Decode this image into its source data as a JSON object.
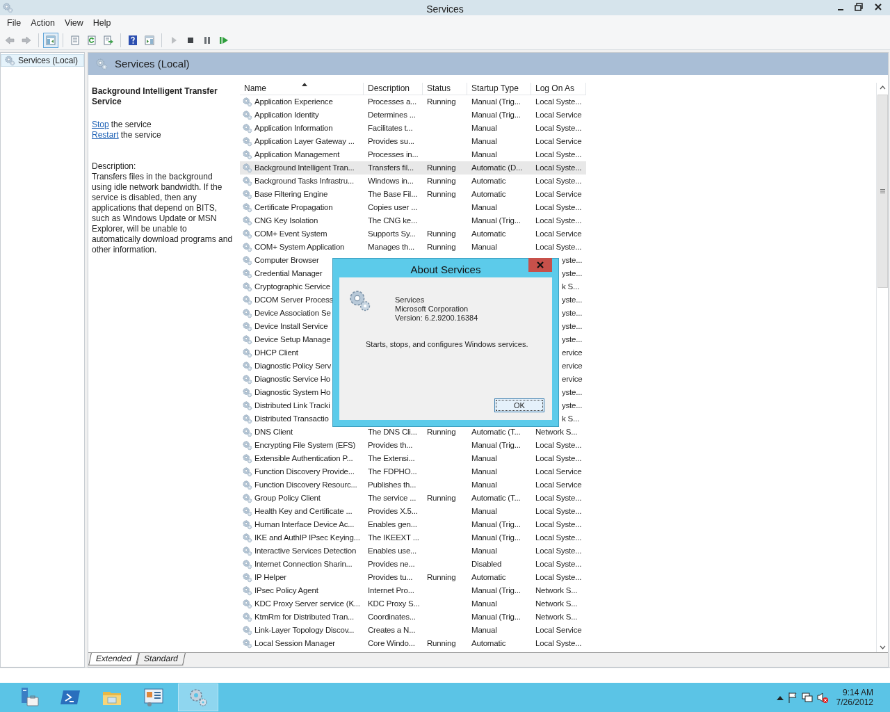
{
  "window": {
    "title": "Services"
  },
  "menu": [
    "File",
    "Action",
    "View",
    "Help"
  ],
  "toolbar": [
    {
      "kind": "back",
      "disabled": true
    },
    {
      "kind": "forward",
      "disabled": true
    },
    {
      "kind": "sep"
    },
    {
      "kind": "console_tree",
      "pressed": true
    },
    {
      "kind": "sep"
    },
    {
      "kind": "properties"
    },
    {
      "kind": "refresh"
    },
    {
      "kind": "export"
    },
    {
      "kind": "sep"
    },
    {
      "kind": "help"
    },
    {
      "kind": "view"
    },
    {
      "kind": "sep"
    },
    {
      "kind": "start",
      "disabled": true
    },
    {
      "kind": "stop"
    },
    {
      "kind": "pause"
    },
    {
      "kind": "resume"
    }
  ],
  "tree": [
    {
      "label": "Services (Local)",
      "selected": true
    }
  ],
  "pane_header": "Services (Local)",
  "details": {
    "title": "Background Intelligent Transfer Service",
    "actions": [
      {
        "link": "Stop",
        "text": "the service"
      },
      {
        "link": "Restart",
        "text": "the service"
      }
    ],
    "description_label": "Description:",
    "description": "Transfers files in the background using idle network bandwidth. If the service is disabled, then any applications that depend on BITS, such as Windows Update or MSN Explorer, will be unable to automatically download programs and other information."
  },
  "table": {
    "columns": [
      {
        "label": "Name",
        "sorted": true
      },
      {
        "label": "Description",
        "sorted": false
      },
      {
        "label": "Status",
        "sorted": false
      },
      {
        "label": "Startup Type",
        "sorted": false
      },
      {
        "label": "Log On As",
        "sorted": false
      }
    ],
    "rows": [
      {
        "kind": "full",
        "selected": false,
        "name": "Application Experience",
        "description": "Processes a...",
        "status": "Running",
        "startup_type": "Manual (Trig...",
        "log_on_as": "Local Syste..."
      },
      {
        "kind": "full",
        "selected": false,
        "name": "Application Identity",
        "description": "Determines ...",
        "startup_type": "Manual (Trig...",
        "log_on_as": "Local Service"
      },
      {
        "kind": "full",
        "selected": false,
        "name": "Application Information",
        "description": "Facilitates t...",
        "startup_type": "Manual",
        "log_on_as": "Local Syste..."
      },
      {
        "kind": "full",
        "selected": false,
        "name": "Application Layer Gateway ...",
        "description": "Provides su...",
        "startup_type": "Manual",
        "log_on_as": "Local Service"
      },
      {
        "kind": "full",
        "selected": false,
        "name": "Application Management",
        "description": "Processes in...",
        "startup_type": "Manual",
        "log_on_as": "Local Syste..."
      },
      {
        "kind": "full",
        "selected": true,
        "name": "Background Intelligent Tran...",
        "description": "Transfers fil...",
        "status": "Running",
        "startup_type": "Automatic (D...",
        "log_on_as": "Local Syste..."
      },
      {
        "kind": "full",
        "selected": false,
        "name": "Background Tasks Infrastru...",
        "description": "Windows in...",
        "status": "Running",
        "startup_type": "Automatic",
        "log_on_as": "Local Syste..."
      },
      {
        "kind": "full",
        "selected": false,
        "name": "Base Filtering Engine",
        "description": "The Base Fil...",
        "status": "Running",
        "startup_type": "Automatic",
        "log_on_as": "Local Service"
      },
      {
        "kind": "full",
        "selected": false,
        "name": "Certificate Propagation",
        "description": "Copies user ...",
        "startup_type": "Manual",
        "log_on_as": "Local Syste..."
      },
      {
        "kind": "full",
        "selected": false,
        "name": "CNG Key Isolation",
        "description": "The CNG ke...",
        "startup_type": "Manual (Trig...",
        "log_on_as": "Local Syste..."
      },
      {
        "kind": "full",
        "selected": false,
        "name": "COM+ Event System",
        "description": "Supports Sy...",
        "status": "Running",
        "startup_type": "Automatic",
        "log_on_as": "Local Service"
      },
      {
        "kind": "full",
        "selected": false,
        "name": "COM+ System Application",
        "description": "Manages th...",
        "status": "Running",
        "startup_type": "Manual",
        "log_on_as": "Local Syste..."
      },
      {
        "kind": "covered",
        "selected": false,
        "name": "Computer Browser",
        "log_on_as": "yste..."
      },
      {
        "kind": "covered",
        "selected": false,
        "name": "Credential Manager",
        "log_on_as": "yste..."
      },
      {
        "kind": "covered",
        "selected": false,
        "name": "Cryptographic Service",
        "log_on_as": "k S..."
      },
      {
        "kind": "covered",
        "selected": false,
        "name": "DCOM Server Process",
        "log_on_as": "yste..."
      },
      {
        "kind": "covered",
        "selected": false,
        "name": "Device Association Se",
        "log_on_as": "yste..."
      },
      {
        "kind": "covered",
        "selected": false,
        "name": "Device Install Service",
        "log_on_as": "yste..."
      },
      {
        "kind": "covered",
        "selected": false,
        "name": "Device Setup Manage",
        "log_on_as": "yste..."
      },
      {
        "kind": "covered",
        "selected": false,
        "name": "DHCP Client",
        "log_on_as": "ervice"
      },
      {
        "kind": "covered",
        "selected": false,
        "name": "Diagnostic Policy Serv",
        "log_on_as": "ervice"
      },
      {
        "kind": "covered",
        "selected": false,
        "name": "Diagnostic Service Ho",
        "log_on_as": "ervice"
      },
      {
        "kind": "covered",
        "selected": false,
        "name": "Diagnostic System Ho",
        "log_on_as": "yste..."
      },
      {
        "kind": "covered",
        "selected": false,
        "name": "Distributed Link Tracki",
        "log_on_as": "yste..."
      },
      {
        "kind": "covered",
        "selected": false,
        "name": "Distributed Transactio",
        "log_on_as": "k S..."
      },
      {
        "kind": "full",
        "selected": false,
        "name": "DNS Client",
        "description": "The DNS Cli...",
        "status": "Running",
        "startup_type": "Automatic (T...",
        "log_on_as": "Network S..."
      },
      {
        "kind": "full",
        "selected": false,
        "name": "Encrypting File System (EFS)",
        "description": "Provides th...",
        "startup_type": "Manual (Trig...",
        "log_on_as": "Local Syste..."
      },
      {
        "kind": "full",
        "selected": false,
        "name": "Extensible Authentication P...",
        "description": "The Extensi...",
        "startup_type": "Manual",
        "log_on_as": "Local Syste..."
      },
      {
        "kind": "full",
        "selected": false,
        "name": "Function Discovery Provide...",
        "description": "The FDPHO...",
        "startup_type": "Manual",
        "log_on_as": "Local Service"
      },
      {
        "kind": "full",
        "selected": false,
        "name": "Function Discovery Resourc...",
        "description": "Publishes th...",
        "startup_type": "Manual",
        "log_on_as": "Local Service"
      },
      {
        "kind": "full",
        "selected": false,
        "name": "Group Policy Client",
        "description": "The service ...",
        "status": "Running",
        "startup_type": "Automatic (T...",
        "log_on_as": "Local Syste..."
      },
      {
        "kind": "full",
        "selected": false,
        "name": "Health Key and Certificate ...",
        "description": "Provides X.5...",
        "startup_type": "Manual",
        "log_on_as": "Local Syste..."
      },
      {
        "kind": "full",
        "selected": false,
        "name": "Human Interface Device Ac...",
        "description": "Enables gen...",
        "startup_type": "Manual (Trig...",
        "log_on_as": "Local Syste..."
      },
      {
        "kind": "full",
        "selected": false,
        "name": "IKE and AuthIP IPsec Keying...",
        "description": "The IKEEXT ...",
        "startup_type": "Manual (Trig...",
        "log_on_as": "Local Syste..."
      },
      {
        "kind": "full",
        "selected": false,
        "name": "Interactive Services Detection",
        "description": "Enables use...",
        "startup_type": "Manual",
        "log_on_as": "Local Syste..."
      },
      {
        "kind": "full",
        "selected": false,
        "name": "Internet Connection Sharin...",
        "description": "Provides ne...",
        "startup_type": "Disabled",
        "log_on_as": "Local Syste..."
      },
      {
        "kind": "full",
        "selected": false,
        "name": "IP Helper",
        "description": "Provides tu...",
        "status": "Running",
        "startup_type": "Automatic",
        "log_on_as": "Local Syste..."
      },
      {
        "kind": "full",
        "selected": false,
        "name": "IPsec Policy Agent",
        "description": "Internet Pro...",
        "startup_type": "Manual (Trig...",
        "log_on_as": "Network S..."
      },
      {
        "kind": "full",
        "selected": false,
        "name": "KDC Proxy Server service (K...",
        "description": "KDC Proxy S...",
        "startup_type": "Manual",
        "log_on_as": "Network S..."
      },
      {
        "kind": "full",
        "selected": false,
        "name": "KtmRm for Distributed Tran...",
        "description": "Coordinates...",
        "startup_type": "Manual (Trig...",
        "log_on_as": "Network S..."
      },
      {
        "kind": "full",
        "selected": false,
        "name": "Link-Layer Topology Discov...",
        "description": "Creates a N...",
        "startup_type": "Manual",
        "log_on_as": "Local Service"
      },
      {
        "kind": "full",
        "selected": false,
        "name": "Local Session Manager",
        "description": "Core Windo...",
        "status": "Running",
        "startup_type": "Automatic",
        "log_on_as": "Local Syste..."
      }
    ]
  },
  "tabs": [
    {
      "label": "Extended",
      "selected": true
    },
    {
      "label": "Standard",
      "selected": false
    }
  ],
  "dialog": {
    "title": "About Services",
    "product": "Services",
    "company": "Microsoft Corporation",
    "version": "Version: 6.2.9200.16384",
    "summary": "Starts, stops, and configures Windows services.",
    "ok": "OK"
  },
  "taskbar": {
    "apps": [
      {
        "kind": "server_manager",
        "active": false
      },
      {
        "kind": "powershell",
        "active": false
      },
      {
        "kind": "explorer",
        "active": false
      },
      {
        "kind": "control_panel",
        "active": false
      },
      {
        "kind": "services",
        "active": true
      }
    ],
    "time": "9:14 AM",
    "date": "7/26/2012"
  }
}
